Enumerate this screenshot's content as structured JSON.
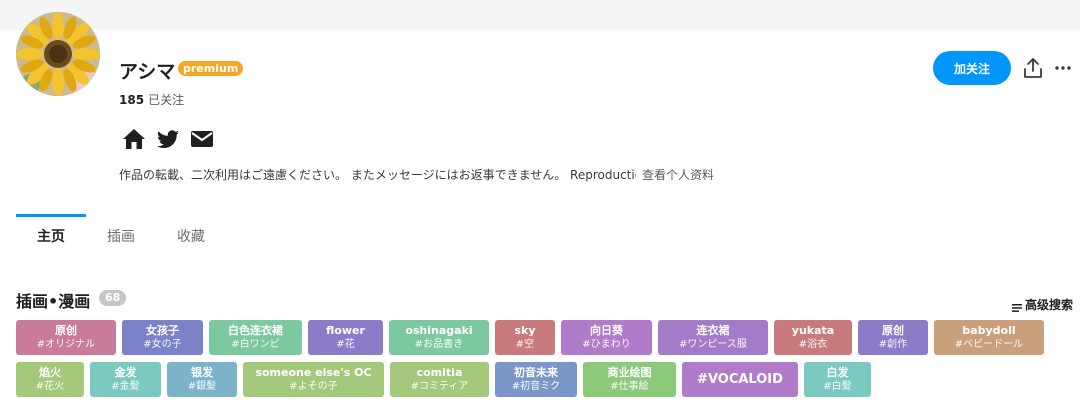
{
  "profile": {
    "name": "アシマ",
    "badge": "premium",
    "following_count": "185",
    "following_label": "已关注",
    "bio": "作品の転載、二次利用はご遠慮ください。 またメッセージにはお返事できません。 Reproduction",
    "bio_more": "查看个人资料",
    "social_icons": [
      "home-icon",
      "twitter-icon",
      "mail-icon"
    ]
  },
  "actions": {
    "follow_label": "加关注",
    "share_icon": "share-icon",
    "more_icon": "more-icon"
  },
  "tabs": [
    {
      "label": "主页",
      "active": true
    },
    {
      "label": "插画",
      "active": false
    },
    {
      "label": "收藏",
      "active": false
    }
  ],
  "section": {
    "title": "插画•漫画",
    "count": "68",
    "advanced_search": "高级搜索"
  },
  "tags": [
    {
      "main": "原创",
      "sub": "#オリジナル",
      "color": "#c97b9c"
    },
    {
      "main": "女孩子",
      "sub": "#女の子",
      "color": "#7b82c9"
    },
    {
      "main": "白色连衣裙",
      "sub": "#白ワンピ",
      "color": "#7cc9a0"
    },
    {
      "main": "flower",
      "sub": "#花",
      "color": "#8c7bc9"
    },
    {
      "main": "oshinagaki",
      "sub": "#お品書き",
      "color": "#7cc9a0"
    },
    {
      "main": "sky",
      "sub": "#空",
      "color": "#c97b7b"
    },
    {
      "main": "向日葵",
      "sub": "#ひまわり",
      "color": "#b07bc9"
    },
    {
      "main": "连衣裙",
      "sub": "#ワンピース服",
      "color": "#a47bc9"
    },
    {
      "main": "yukata",
      "sub": "#浴衣",
      "color": "#c97b7b"
    },
    {
      "main": "原创",
      "sub": "#創作",
      "color": "#8c7bc9"
    },
    {
      "main": "babydoll",
      "sub": "#ベビードール",
      "color": "#c9a07b"
    },
    {
      "main": "焰火",
      "sub": "#花火",
      "color": "#a4c97b"
    },
    {
      "main": "金发",
      "sub": "#金髪",
      "color": "#7cc9c0"
    },
    {
      "main": "银发",
      "sub": "#銀髪",
      "color": "#7bb4c9"
    },
    {
      "main": "someone else's OC",
      "sub": "#よその子",
      "color": "#a4c97b"
    },
    {
      "main": "comitia",
      "sub": "#コミティア",
      "color": "#a4c97b"
    },
    {
      "main": "初音未来",
      "sub": "#初音ミク",
      "color": "#7b97c9"
    },
    {
      "main": "商业绘图",
      "sub": "#仕事絵",
      "color": "#8cc97b"
    },
    {
      "main": "#VOCALOID",
      "sub": "",
      "color": "#b07bc9"
    },
    {
      "main": "白发",
      "sub": "#白髪",
      "color": "#7cc9c0"
    }
  ]
}
